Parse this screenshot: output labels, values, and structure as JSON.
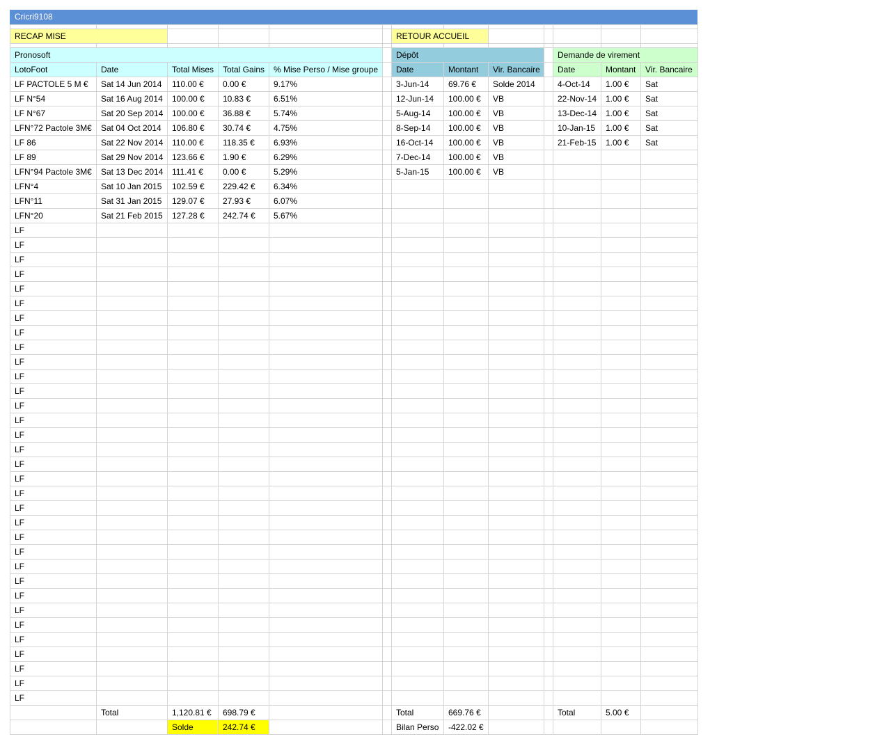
{
  "sheet": {
    "title": "Cricri9108"
  },
  "nav": {
    "recap": "RECAP MISE",
    "home": "RETOUR ACCUEIL"
  },
  "pronosoft": {
    "title": "Pronosoft",
    "headers": [
      "LotoFoot",
      "Date",
      "Total Mises",
      "Total Gains",
      "% Mise Perso / Mise groupe"
    ],
    "rows": [
      [
        "LF PACTOLE 5 M €",
        "Sat 14 Jun 2014",
        "110.00 €",
        "0.00 €",
        "9.17%"
      ],
      [
        "LF N°54",
        "Sat 16 Aug 2014",
        "100.00 €",
        "10.83 €",
        "6.51%"
      ],
      [
        "LF N°67",
        "Sat 20 Sep 2014",
        "100.00 €",
        "36.88 €",
        "5.74%"
      ],
      [
        "LFN°72 Pactole 3M€",
        "Sat 04 Oct 2014",
        "106.80 €",
        "30.74 €",
        "4.75%"
      ],
      [
        "LF 86",
        "Sat 22 Nov 2014",
        "110.00 €",
        "118.35 €",
        "6.93%"
      ],
      [
        "LF 89",
        "Sat 29 Nov 2014",
        "123.66 €",
        "1.90 €",
        "6.29%"
      ],
      [
        "LFN°94 Pactole 3M€",
        "Sat 13 Dec 2014",
        "111.41 €",
        "0.00 €",
        "5.29%"
      ],
      [
        "LFN°4",
        "Sat 10 Jan 2015",
        "102.59 €",
        "229.42 €",
        "6.34%"
      ],
      [
        "LFN°11",
        "Sat 31 Jan 2015",
        "129.07 €",
        "27.93 €",
        "6.07%"
      ],
      [
        "LFN°20",
        "Sat 21 Feb 2015",
        "127.28 €",
        "242.74 €",
        "5.67%"
      ]
    ],
    "placeholder": "LF",
    "total_label": "Total",
    "total_mises": "1,120.81 €",
    "total_gains": "698.79 €",
    "solde_label": "Solde",
    "solde_value": "242.74 €"
  },
  "depot": {
    "title": "Dépôt",
    "headers": [
      "Date",
      "Montant",
      "Vir. Bancaire"
    ],
    "rows": [
      [
        "3-Jun-14",
        "69.76 €",
        "Solde 2014"
      ],
      [
        "12-Jun-14",
        "100.00 €",
        "VB"
      ],
      [
        "5-Aug-14",
        "100.00 €",
        "VB"
      ],
      [
        "8-Sep-14",
        "100.00 €",
        "VB"
      ],
      [
        "16-Oct-14",
        "100.00 €",
        "VB"
      ],
      [
        "7-Dec-14",
        "100.00 €",
        "VB"
      ],
      [
        "5-Jan-15",
        "100.00 €",
        "VB"
      ]
    ],
    "total_label": "Total",
    "total_value": "669.76 €",
    "bilan_label": "Bilan Perso",
    "bilan_value": "-422.02 €"
  },
  "virement": {
    "title": "Demande de virement",
    "headers": [
      "Date",
      "Montant",
      "Vir. Bancaire"
    ],
    "rows": [
      [
        "4-Oct-14",
        "1.00 €",
        "Sat"
      ],
      [
        "22-Nov-14",
        "1.00 €",
        "Sat"
      ],
      [
        "13-Dec-14",
        "1.00 €",
        "Sat"
      ],
      [
        "10-Jan-15",
        "1.00 €",
        "Sat"
      ],
      [
        "21-Feb-15",
        "1.00 €",
        "Sat"
      ]
    ],
    "total_label": "Total",
    "total_value": "5.00 €"
  },
  "colors": {
    "title_bar": "#5b8fd6",
    "yellow": "#ffff99",
    "cyan": "#ccffff",
    "blue": "#93cddd",
    "green": "#ccffcc",
    "solde": "#ffff00"
  }
}
